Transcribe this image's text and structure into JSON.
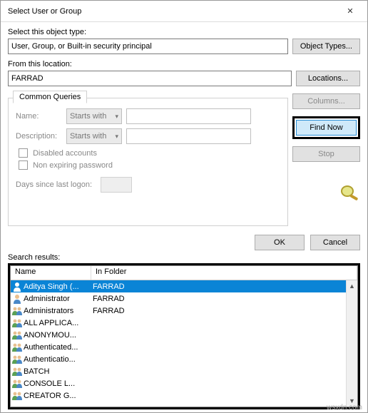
{
  "window": {
    "title": "Select User or Group"
  },
  "objectType": {
    "label": "Select this object type:",
    "value": "User, Group, or Built-in security principal",
    "button": "Object Types..."
  },
  "location": {
    "label": "From this location:",
    "value": "FARRAD",
    "button": "Locations..."
  },
  "queries": {
    "tab": "Common Queries",
    "name_label": "Name:",
    "description_label": "Description:",
    "starts_with": "Starts with",
    "disabled_accounts": "Disabled accounts",
    "non_expiring": "Non expiring password",
    "days_since": "Days since last logon:",
    "columns_btn": "Columns...",
    "findnow_btn": "Find Now",
    "stop_btn": "Stop"
  },
  "dialog": {
    "ok": "OK",
    "cancel": "Cancel"
  },
  "search": {
    "label": "Search results:",
    "columns": {
      "name": "Name",
      "folder": "In Folder"
    },
    "rows": [
      {
        "icon": "user",
        "name": "Aditya Singh (...",
        "folder": "FARRAD",
        "selected": true
      },
      {
        "icon": "user",
        "name": "Administrator",
        "folder": "FARRAD"
      },
      {
        "icon": "group",
        "name": "Administrators",
        "folder": "FARRAD"
      },
      {
        "icon": "group",
        "name": "ALL APPLICA...",
        "folder": ""
      },
      {
        "icon": "group",
        "name": "ANONYMOU...",
        "folder": ""
      },
      {
        "icon": "group",
        "name": "Authenticated...",
        "folder": ""
      },
      {
        "icon": "group",
        "name": "Authenticatio...",
        "folder": ""
      },
      {
        "icon": "group",
        "name": "BATCH",
        "folder": ""
      },
      {
        "icon": "group",
        "name": "CONSOLE L...",
        "folder": ""
      },
      {
        "icon": "group",
        "name": "CREATOR G...",
        "folder": ""
      }
    ]
  },
  "watermark": "wsxdn.com"
}
